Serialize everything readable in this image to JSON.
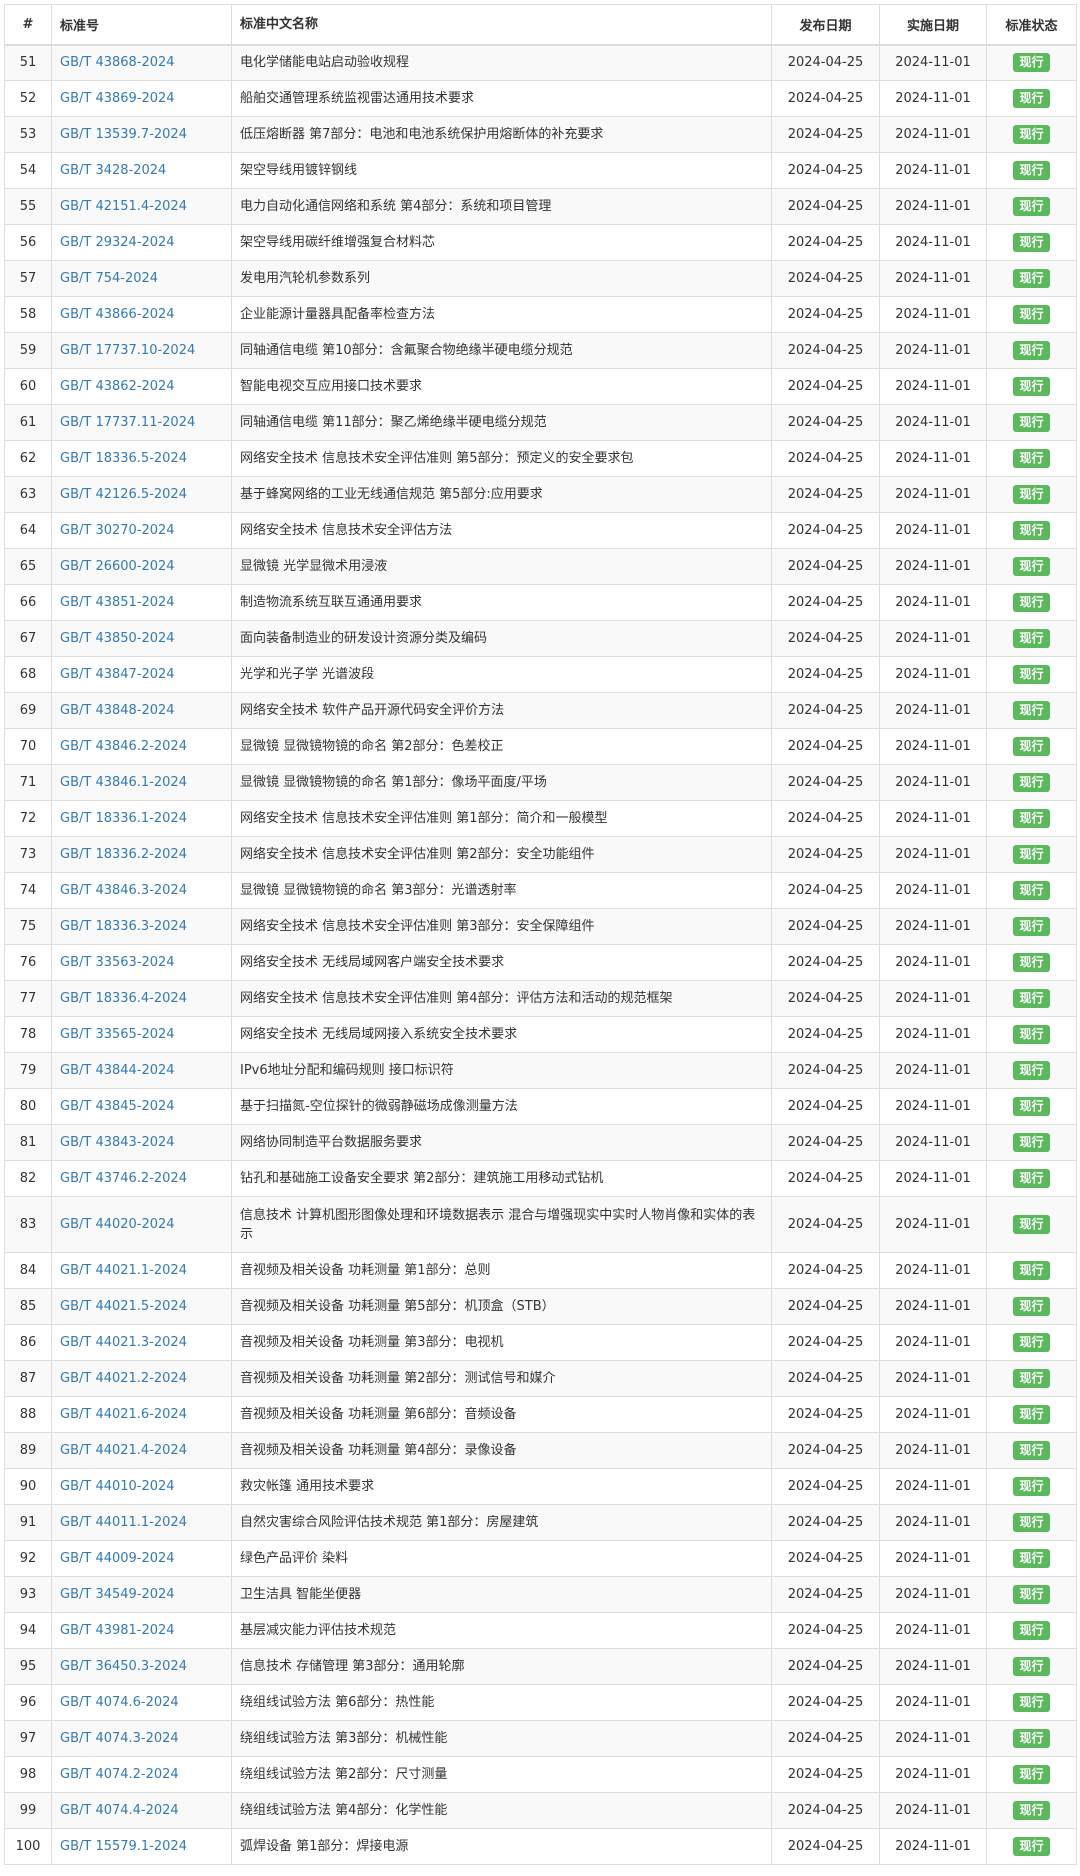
{
  "table": {
    "headers": {
      "num": "#",
      "code": "标准号",
      "name": "标准中文名称",
      "publish": "发布日期",
      "implement": "实施日期",
      "status": "标准状态"
    },
    "colors": {
      "link": "#337ab7",
      "status_badge": "#5cb85c",
      "stripe": "#f9f9f9",
      "border": "#dddddd"
    },
    "rows": [
      {
        "num": "51",
        "code": "GB/T 43868-2024",
        "name": "电化学储能电站启动验收规程",
        "publish": "2024-04-25",
        "implement": "2024-11-01",
        "status": "现行"
      },
      {
        "num": "52",
        "code": "GB/T 43869-2024",
        "name": "船舶交通管理系统监视雷达通用技术要求",
        "publish": "2024-04-25",
        "implement": "2024-11-01",
        "status": "现行"
      },
      {
        "num": "53",
        "code": "GB/T 13539.7-2024",
        "name": "低压熔断器 第7部分：电池和电池系统保护用熔断体的补充要求",
        "publish": "2024-04-25",
        "implement": "2024-11-01",
        "status": "现行"
      },
      {
        "num": "54",
        "code": "GB/T 3428-2024",
        "name": "架空导线用镀锌钢线",
        "publish": "2024-04-25",
        "implement": "2024-11-01",
        "status": "现行"
      },
      {
        "num": "55",
        "code": "GB/T 42151.4-2024",
        "name": "电力自动化通信网络和系统 第4部分：系统和项目管理",
        "publish": "2024-04-25",
        "implement": "2024-11-01",
        "status": "现行"
      },
      {
        "num": "56",
        "code": "GB/T 29324-2024",
        "name": "架空导线用碳纤维增强复合材料芯",
        "publish": "2024-04-25",
        "implement": "2024-11-01",
        "status": "现行"
      },
      {
        "num": "57",
        "code": "GB/T 754-2024",
        "name": "发电用汽轮机参数系列",
        "publish": "2024-04-25",
        "implement": "2024-11-01",
        "status": "现行"
      },
      {
        "num": "58",
        "code": "GB/T 43866-2024",
        "name": "企业能源计量器具配备率检查方法",
        "publish": "2024-04-25",
        "implement": "2024-11-01",
        "status": "现行"
      },
      {
        "num": "59",
        "code": "GB/T 17737.10-2024",
        "name": "同轴通信电缆 第10部分：含氟聚合物绝缘半硬电缆分规范",
        "publish": "2024-04-25",
        "implement": "2024-11-01",
        "status": "现行"
      },
      {
        "num": "60",
        "code": "GB/T 43862-2024",
        "name": "智能电视交互应用接口技术要求",
        "publish": "2024-04-25",
        "implement": "2024-11-01",
        "status": "现行"
      },
      {
        "num": "61",
        "code": "GB/T 17737.11-2024",
        "name": "同轴通信电缆 第11部分：聚乙烯绝缘半硬电缆分规范",
        "publish": "2024-04-25",
        "implement": "2024-11-01",
        "status": "现行"
      },
      {
        "num": "62",
        "code": "GB/T 18336.5-2024",
        "name": "网络安全技术 信息技术安全评估准则 第5部分：预定义的安全要求包",
        "publish": "2024-04-25",
        "implement": "2024-11-01",
        "status": "现行"
      },
      {
        "num": "63",
        "code": "GB/T 42126.5-2024",
        "name": "基于蜂窝网络的工业无线通信规范 第5部分:应用要求",
        "publish": "2024-04-25",
        "implement": "2024-11-01",
        "status": "现行"
      },
      {
        "num": "64",
        "code": "GB/T 30270-2024",
        "name": "网络安全技术 信息技术安全评估方法",
        "publish": "2024-04-25",
        "implement": "2024-11-01",
        "status": "现行"
      },
      {
        "num": "65",
        "code": "GB/T 26600-2024",
        "name": "显微镜 光学显微术用浸液",
        "publish": "2024-04-25",
        "implement": "2024-11-01",
        "status": "现行"
      },
      {
        "num": "66",
        "code": "GB/T 43851-2024",
        "name": "制造物流系统互联互通通用要求",
        "publish": "2024-04-25",
        "implement": "2024-11-01",
        "status": "现行"
      },
      {
        "num": "67",
        "code": "GB/T 43850-2024",
        "name": "面向装备制造业的研发设计资源分类及编码",
        "publish": "2024-04-25",
        "implement": "2024-11-01",
        "status": "现行"
      },
      {
        "num": "68",
        "code": "GB/T 43847-2024",
        "name": "光学和光子学 光谱波段",
        "publish": "2024-04-25",
        "implement": "2024-11-01",
        "status": "现行"
      },
      {
        "num": "69",
        "code": "GB/T 43848-2024",
        "name": "网络安全技术 软件产品开源代码安全评价方法",
        "publish": "2024-04-25",
        "implement": "2024-11-01",
        "status": "现行"
      },
      {
        "num": "70",
        "code": "GB/T 43846.2-2024",
        "name": "显微镜 显微镜物镜的命名 第2部分：色差校正",
        "publish": "2024-04-25",
        "implement": "2024-11-01",
        "status": "现行"
      },
      {
        "num": "71",
        "code": "GB/T 43846.1-2024",
        "name": "显微镜 显微镜物镜的命名 第1部分：像场平面度/平场",
        "publish": "2024-04-25",
        "implement": "2024-11-01",
        "status": "现行"
      },
      {
        "num": "72",
        "code": "GB/T 18336.1-2024",
        "name": "网络安全技术 信息技术安全评估准则 第1部分：简介和一般模型",
        "publish": "2024-04-25",
        "implement": "2024-11-01",
        "status": "现行"
      },
      {
        "num": "73",
        "code": "GB/T 18336.2-2024",
        "name": "网络安全技术 信息技术安全评估准则 第2部分：安全功能组件",
        "publish": "2024-04-25",
        "implement": "2024-11-01",
        "status": "现行"
      },
      {
        "num": "74",
        "code": "GB/T 43846.3-2024",
        "name": "显微镜 显微镜物镜的命名 第3部分：光谱透射率",
        "publish": "2024-04-25",
        "implement": "2024-11-01",
        "status": "现行"
      },
      {
        "num": "75",
        "code": "GB/T 18336.3-2024",
        "name": "网络安全技术 信息技术安全评估准则 第3部分：安全保障组件",
        "publish": "2024-04-25",
        "implement": "2024-11-01",
        "status": "现行"
      },
      {
        "num": "76",
        "code": "GB/T 33563-2024",
        "name": "网络安全技术 无线局域网客户端安全技术要求",
        "publish": "2024-04-25",
        "implement": "2024-11-01",
        "status": "现行"
      },
      {
        "num": "77",
        "code": "GB/T 18336.4-2024",
        "name": "网络安全技术 信息技术安全评估准则 第4部分：评估方法和活动的规范框架",
        "publish": "2024-04-25",
        "implement": "2024-11-01",
        "status": "现行"
      },
      {
        "num": "78",
        "code": "GB/T 33565-2024",
        "name": "网络安全技术 无线局域网接入系统安全技术要求",
        "publish": "2024-04-25",
        "implement": "2024-11-01",
        "status": "现行"
      },
      {
        "num": "79",
        "code": "GB/T 43844-2024",
        "name": "IPv6地址分配和编码规则 接口标识符",
        "publish": "2024-04-25",
        "implement": "2024-11-01",
        "status": "现行"
      },
      {
        "num": "80",
        "code": "GB/T 43845-2024",
        "name": "基于扫描氮-空位探针的微弱静磁场成像测量方法",
        "publish": "2024-04-25",
        "implement": "2024-11-01",
        "status": "现行"
      },
      {
        "num": "81",
        "code": "GB/T 43843-2024",
        "name": "网络协同制造平台数据服务要求",
        "publish": "2024-04-25",
        "implement": "2024-11-01",
        "status": "现行"
      },
      {
        "num": "82",
        "code": "GB/T 43746.2-2024",
        "name": "钻孔和基础施工设备安全要求 第2部分：建筑施工用移动式钻机",
        "publish": "2024-04-25",
        "implement": "2024-11-01",
        "status": "现行"
      },
      {
        "num": "83",
        "code": "GB/T 44020-2024",
        "name": "信息技术 计算机图形图像处理和环境数据表示 混合与增强现实中实时人物肖像和实体的表示",
        "publish": "2024-04-25",
        "implement": "2024-11-01",
        "status": "现行",
        "tall": true
      },
      {
        "num": "84",
        "code": "GB/T 44021.1-2024",
        "name": "音视频及相关设备 功耗测量 第1部分：总则",
        "publish": "2024-04-25",
        "implement": "2024-11-01",
        "status": "现行"
      },
      {
        "num": "85",
        "code": "GB/T 44021.5-2024",
        "name": "音视频及相关设备 功耗测量 第5部分：机顶盒（STB）",
        "publish": "2024-04-25",
        "implement": "2024-11-01",
        "status": "现行"
      },
      {
        "num": "86",
        "code": "GB/T 44021.3-2024",
        "name": "音视频及相关设备 功耗测量 第3部分：电视机",
        "publish": "2024-04-25",
        "implement": "2024-11-01",
        "status": "现行"
      },
      {
        "num": "87",
        "code": "GB/T 44021.2-2024",
        "name": "音视频及相关设备 功耗测量 第2部分：测试信号和媒介",
        "publish": "2024-04-25",
        "implement": "2024-11-01",
        "status": "现行"
      },
      {
        "num": "88",
        "code": "GB/T 44021.6-2024",
        "name": "音视频及相关设备 功耗测量 第6部分：音频设备",
        "publish": "2024-04-25",
        "implement": "2024-11-01",
        "status": "现行"
      },
      {
        "num": "89",
        "code": "GB/T 44021.4-2024",
        "name": "音视频及相关设备 功耗测量 第4部分：录像设备",
        "publish": "2024-04-25",
        "implement": "2024-11-01",
        "status": "现行"
      },
      {
        "num": "90",
        "code": "GB/T 44010-2024",
        "name": "救灾帐篷 通用技术要求",
        "publish": "2024-04-25",
        "implement": "2024-11-01",
        "status": "现行"
      },
      {
        "num": "91",
        "code": "GB/T 44011.1-2024",
        "name": "自然灾害综合风险评估技术规范 第1部分：房屋建筑",
        "publish": "2024-04-25",
        "implement": "2024-11-01",
        "status": "现行"
      },
      {
        "num": "92",
        "code": "GB/T 44009-2024",
        "name": "绿色产品评价 染料",
        "publish": "2024-04-25",
        "implement": "2024-11-01",
        "status": "现行"
      },
      {
        "num": "93",
        "code": "GB/T 34549-2024",
        "name": "卫生洁具 智能坐便器",
        "publish": "2024-04-25",
        "implement": "2024-11-01",
        "status": "现行"
      },
      {
        "num": "94",
        "code": "GB/T 43981-2024",
        "name": "基层减灾能力评估技术规范",
        "publish": "2024-04-25",
        "implement": "2024-11-01",
        "status": "现行"
      },
      {
        "num": "95",
        "code": "GB/T 36450.3-2024",
        "name": "信息技术 存储管理 第3部分：通用轮廓",
        "publish": "2024-04-25",
        "implement": "2024-11-01",
        "status": "现行"
      },
      {
        "num": "96",
        "code": "GB/T 4074.6-2024",
        "name": "绕组线试验方法 第6部分：热性能",
        "publish": "2024-04-25",
        "implement": "2024-11-01",
        "status": "现行"
      },
      {
        "num": "97",
        "code": "GB/T 4074.3-2024",
        "name": "绕组线试验方法 第3部分：机械性能",
        "publish": "2024-04-25",
        "implement": "2024-11-01",
        "status": "现行"
      },
      {
        "num": "98",
        "code": "GB/T 4074.2-2024",
        "name": "绕组线试验方法 第2部分：尺寸测量",
        "publish": "2024-04-25",
        "implement": "2024-11-01",
        "status": "现行"
      },
      {
        "num": "99",
        "code": "GB/T 4074.4-2024",
        "name": "绕组线试验方法 第4部分：化学性能",
        "publish": "2024-04-25",
        "implement": "2024-11-01",
        "status": "现行"
      },
      {
        "num": "100",
        "code": "GB/T 15579.1-2024",
        "name": "弧焊设备 第1部分：焊接电源",
        "publish": "2024-04-25",
        "implement": "2024-11-01",
        "status": "现行"
      }
    ]
  }
}
